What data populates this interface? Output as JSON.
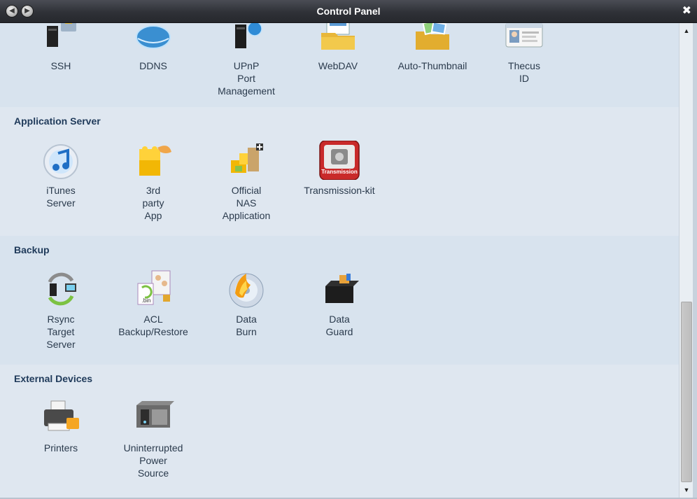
{
  "window": {
    "title": "Control Panel",
    "close_glyph": "✖",
    "back_glyph": "◀",
    "forward_glyph": "▶"
  },
  "top_row": {
    "items": [
      {
        "label": "SSH",
        "icon": "ssh-icon"
      },
      {
        "label": "DDNS",
        "icon": "ddns-globe-icon"
      },
      {
        "label": "UPnP\nPort\nManagement",
        "icon": "upnp-icon"
      },
      {
        "label": "WebDAV",
        "icon": "webdav-folder-icon"
      },
      {
        "label": "Auto-Thumbnail",
        "icon": "auto-thumbnail-icon"
      },
      {
        "label": "Thecus\nID",
        "icon": "thecus-id-card-icon"
      }
    ]
  },
  "sections": [
    {
      "title": "Application Server",
      "items": [
        {
          "label": "iTunes\nServer",
          "icon": "itunes-icon"
        },
        {
          "label": "3rd\nparty\nApp",
          "icon": "third-party-app-icon"
        },
        {
          "label": "Official\nNAS\nApplication",
          "icon": "official-nas-app-icon"
        },
        {
          "label": "Transmission-kit",
          "icon": "transmission-icon",
          "icon_text": "Transmission"
        }
      ]
    },
    {
      "title": "Backup",
      "items": [
        {
          "label": "Rsync\nTarget\nServer",
          "icon": "rsync-icon"
        },
        {
          "label": "ACL\nBackup/Restore",
          "icon": "acl-backup-icon",
          "icon_text": ".bin"
        },
        {
          "label": "Data\nBurn",
          "icon": "data-burn-disc-icon"
        },
        {
          "label": "Data\nGuard",
          "icon": "data-guard-icon"
        }
      ]
    },
    {
      "title": "External Devices",
      "items": [
        {
          "label": "Printers",
          "icon": "printer-icon"
        },
        {
          "label": "Uninterrupted\nPower\nSource",
          "icon": "ups-icon"
        }
      ]
    }
  ],
  "scrollbar": {
    "up_glyph": "▲",
    "down_glyph": "▼"
  },
  "colors": {
    "titlebar": "#2f3137",
    "section_title": "#1f3a5a",
    "content_bg": "#dbe5ef",
    "transmission_red": "#c92a2a"
  }
}
